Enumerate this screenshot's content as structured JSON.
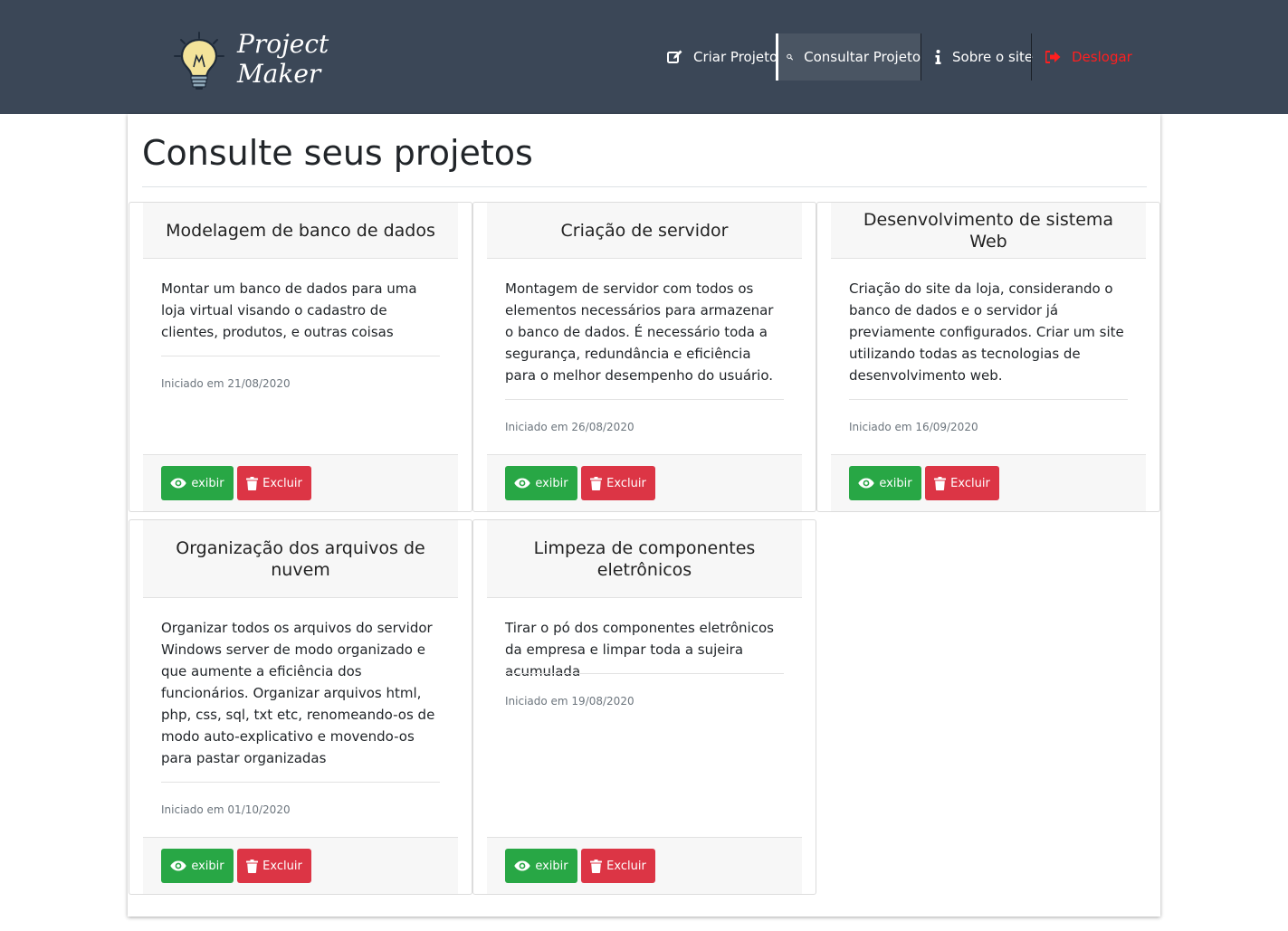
{
  "brand": {
    "line1": "Project",
    "line2": "Maker"
  },
  "nav": {
    "criar": "Criar Projeto",
    "consultar": "Consultar Projeto",
    "sobre": "Sobre o site",
    "deslogar": "Deslogar"
  },
  "page": {
    "title": "Consulte seus projetos"
  },
  "projects": [
    {
      "title": "Modelagem de banco de dados",
      "description": "Montar um banco de dados para uma loja virtual visando o cadastro de clientes, produtos, e outras coisas",
      "started": "Iniciado em 21/08/2020",
      "view_label": "exibir",
      "delete_label": "Excluir"
    },
    {
      "title": "Criação de servidor",
      "description": "Montagem de servidor com todos os elementos necessários para armazenar o banco de dados. É necessário toda a segurança, redundância e eficiência para o melhor desempenho do usuário.",
      "started": "Iniciado em 26/08/2020",
      "view_label": "exibir",
      "delete_label": "Excluir"
    },
    {
      "title": "Desenvolvimento de sistema Web",
      "description": "Criação do site da loja, considerando o banco de dados e o servidor já previamente configurados. Criar um site utilizando todas as tecnologias de desenvolvimento web.",
      "started": "Iniciado em 16/09/2020",
      "view_label": "exibir",
      "delete_label": "Excluir"
    },
    {
      "title": "Organização dos arquivos de nuvem",
      "description": "Organizar todos os arquivos do servidor Windows server de modo organizado e que aumente a eficiência dos funcionários. Organizar arquivos html, php, css, sql, txt etc, renomeando-os de modo auto-explicativo e movendo-os para pastar organizadas",
      "started": "Iniciado em 01/10/2020",
      "view_label": "exibir",
      "delete_label": "Excluir"
    },
    {
      "title": "Limpeza de componentes eletrônicos",
      "description": "Tirar o pó dos componentes eletrônicos da empresa e limpar toda a sujeira acumulada",
      "started": "Iniciado em 19/08/2020",
      "view_label": "exibir",
      "delete_label": "Excluir"
    }
  ],
  "colors": {
    "navbar": "#3b4757",
    "view_button": "#28a745",
    "delete_button": "#dc3545",
    "logout_text": "#ff1f1f"
  },
  "icons": {
    "logo": "lightbulb-icon",
    "criar": "edit-icon",
    "consultar": "search-icon",
    "sobre": "info-icon",
    "deslogar": "sign-out-icon",
    "view": "eye-icon",
    "delete": "trash-icon"
  }
}
